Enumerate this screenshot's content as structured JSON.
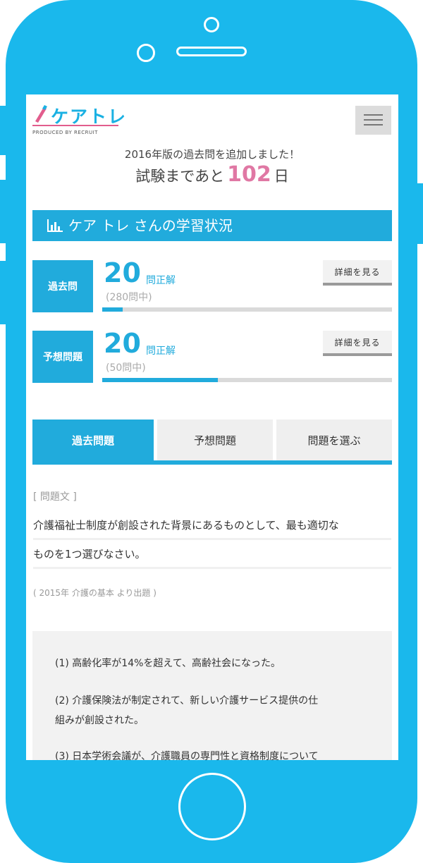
{
  "header": {
    "logo_text": "ケアトレ",
    "logo_sub": "PRODUCED BY RECRUIT"
  },
  "notice": "2016年版の過去問を追加しました！",
  "countdown": {
    "prefix": "試験まであと",
    "days": "102",
    "suffix": "日"
  },
  "status": {
    "title": "ケア トレ さんの学習状況"
  },
  "cards": [
    {
      "label": "過去問",
      "count": "20",
      "unit": "問正解",
      "total": "(280問中)",
      "progress": 0.0714,
      "detail_label": "詳細を見る"
    },
    {
      "label": "予想問題",
      "count": "20",
      "unit": "問正解",
      "total": "(50問中)",
      "progress": 0.4,
      "detail_label": "詳細を見る"
    }
  ],
  "tabs": [
    {
      "label": "過去問題",
      "active": true
    },
    {
      "label": "予想問題",
      "active": false
    },
    {
      "label": "問題を選ぶ",
      "active": false
    }
  ],
  "question": {
    "label": "[ 問題文 ]",
    "line1": "介護福祉士制度が創設された背景にあるものとして、最も適切な",
    "line2": "ものを1つ選びなさい。",
    "source": "( 2015年 介護の基本 より出題 )"
  },
  "choices": [
    {
      "line1": "(1)  高齢化率が14%を超えて、高齢社会になった。",
      "line2": ""
    },
    {
      "line1": "(2)  介護保険法が制定されて、新しい介護サービス提供の仕",
      "line2": "組みが創設された。"
    },
    {
      "line1": "(3)  日本学術会議が、介護職員の専門性と資格制度について",
      "line2": ""
    }
  ],
  "colors": {
    "accent": "#21abdc",
    "frame": "#1ab8ec",
    "highlight": "#e078a4"
  }
}
